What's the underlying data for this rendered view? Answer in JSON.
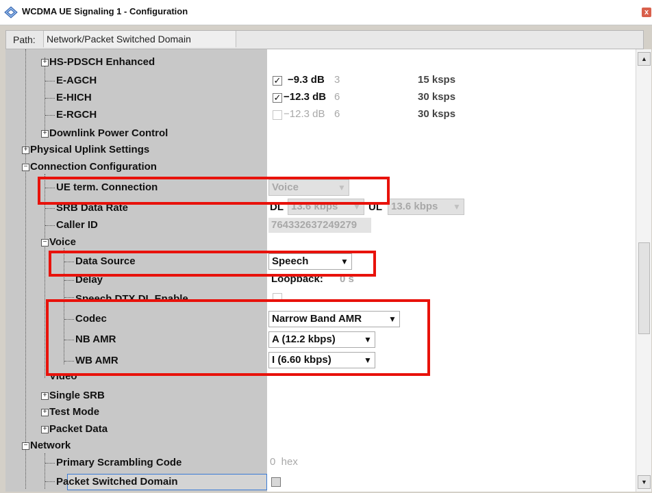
{
  "window": {
    "title": "WCDMA UE Signaling 1 - Configuration",
    "close_label": "x"
  },
  "path": {
    "label": "Path:",
    "value": "Network/Packet Switched Domain"
  },
  "tree": {
    "hs_pdsch": "HS-PDSCH Enhanced",
    "e_agch": "E-AGCH",
    "e_hich": "E-HICH",
    "e_rgch": "E-RGCH",
    "dl_power": "Downlink Power Control",
    "phys_uplink": "Physical Uplink Settings",
    "conn_config": "Connection Configuration",
    "ue_term": "UE term. Connection",
    "srb_rate": "SRB Data Rate",
    "caller_id": "Caller ID",
    "voice": "Voice",
    "data_source": "Data Source",
    "delay": "Delay",
    "speech_dtx": "Speech DTX DL Enable",
    "codec": "Codec",
    "nb_amr": "NB AMR",
    "wb_amr": "WB AMR",
    "video": "Video",
    "single_srb": "Single SRB",
    "test_mode": "Test Mode",
    "packet_data": "Packet Data",
    "network": "Network",
    "psc": "Primary Scrambling Code",
    "psd": "Packet Switched Domain"
  },
  "values": {
    "e_agch": {
      "check": "✓",
      "level": "−9.3 dB",
      "num": "3",
      "rate": "15 ksps"
    },
    "e_hich": {
      "check": "✓",
      "level": "−12.3 dB",
      "num": "6",
      "rate": "30 ksps"
    },
    "e_rgch": {
      "level": "−12.3 dB",
      "num": "6",
      "rate": "30 ksps"
    },
    "ue_term": "Voice",
    "srb_dl_label": "DL",
    "srb_dl": "13.6 kbps",
    "srb_ul_label": "UL",
    "srb_ul": "13.6 kbps",
    "caller_id": "764332637249279",
    "data_source": "Speech",
    "delay_label": "Loopback:",
    "delay_value": "0 s",
    "codec": "Narrow Band AMR",
    "nb_amr": "A (12.2 kbps)",
    "wb_amr": "I (6.60 kbps)",
    "psc": "0  hex"
  },
  "colors": {
    "highlight": "#e8120b",
    "tree_bg": "#c8c8c8",
    "focus": "#3a7bd5"
  }
}
